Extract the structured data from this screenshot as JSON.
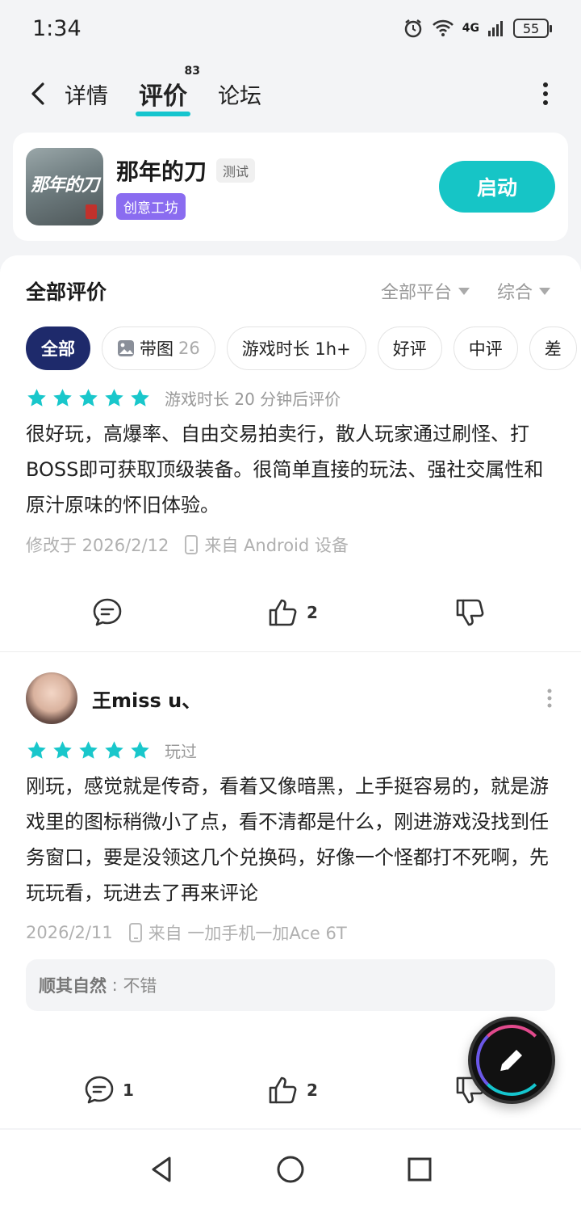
{
  "status_bar": {
    "time": "1:34",
    "network": "4G",
    "battery": "55"
  },
  "nav": {
    "tabs": [
      {
        "label": "详情"
      },
      {
        "label": "评价",
        "badge": "83"
      },
      {
        "label": "论坛"
      }
    ]
  },
  "app": {
    "name": "那年的刀",
    "icon_text": "那年的刀",
    "test_tag": "测试",
    "workshop_tag": "创意工坊",
    "launch_label": "启动"
  },
  "reviews_section": {
    "title": "全部评价",
    "platform_filter": "全部平台",
    "sort_filter": "综合",
    "chips": [
      {
        "label": "全部"
      },
      {
        "label": "带图",
        "count": "26"
      },
      {
        "label": "游戏时长 1h+"
      },
      {
        "label": "好评"
      },
      {
        "label": "中评"
      },
      {
        "label": "差"
      }
    ]
  },
  "reviews": [
    {
      "rating": 5,
      "play_meta": "游戏时长 20 分钟后评价",
      "text": "很好玩，高爆率、自由交易拍卖行，散人玩家通过刷怪、打BOSS即可获取顶级装备。很简单直接的玩法、强社交属性和原汁原味的怀旧体验。",
      "date": "修改于 2026/2/12",
      "device": "来自 Android 设备",
      "comment_count": "",
      "like_count": "2"
    },
    {
      "username": "王miss u、",
      "rating": 5,
      "play_meta": "玩过",
      "text": "刚玩，感觉就是传奇，看着又像暗黑，上手挺容易的，就是游戏里的图标稍微小了点，看不清都是什么，刚进游戏没找到任务窗口，要是没领这几个兑换码，好像一个怪都打不死啊，先玩玩看，玩进去了再来评论",
      "date": "2026/2/11",
      "device": "来自 一加手机一加Ace 6T",
      "dev_reply_name": "顺其自然",
      "dev_reply_text": "不错",
      "comment_count": "1",
      "like_count": "2"
    }
  ],
  "colors": {
    "accent": "#16c5c6",
    "star": "#19c7cb",
    "chip_active": "#1e2a6b",
    "workshop": "#8a6cf0"
  }
}
